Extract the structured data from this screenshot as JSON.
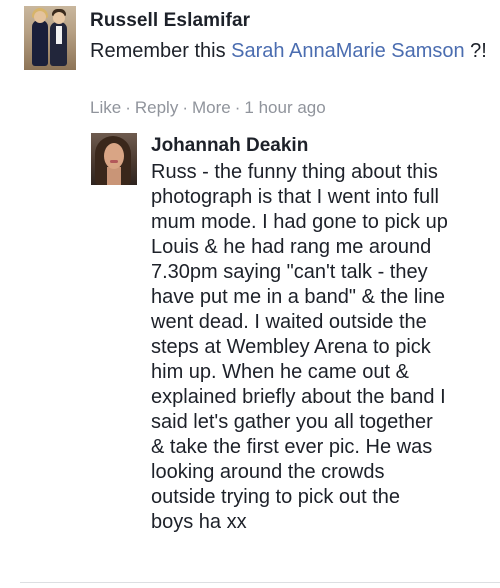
{
  "comment": {
    "author": "Russell Eslamifar",
    "text_before": "Remember this ",
    "mention": "Sarah AnnaMarie Samson",
    "text_after": " ?!",
    "actions": {
      "like": "Like",
      "reply": "Reply",
      "more": "More",
      "time": "1 hour ago",
      "separator": "·"
    }
  },
  "reply": {
    "author": "Johannah Deakin",
    "lines": [
      "Russ - the funny thing about this",
      "photograph is that I went into full",
      "mum mode. I had gone to pick up",
      "Louis & he had rang me around",
      "7.30pm saying \"can't talk - they",
      "have put me in a band\" & the line",
      "went dead. I waited outside the",
      "steps at Wembley Arena to pick",
      "him up. When he came out &",
      "explained briefly about the band I",
      "said let's gather you all together",
      "& take the first ever pic. He was",
      "looking around the crowds",
      "outside trying to pick out the",
      "boys ha xx"
    ]
  },
  "colors": {
    "text": "#1d2129",
    "link": "#4b6db0",
    "meta": "#90949c",
    "background": "#ffffff"
  }
}
